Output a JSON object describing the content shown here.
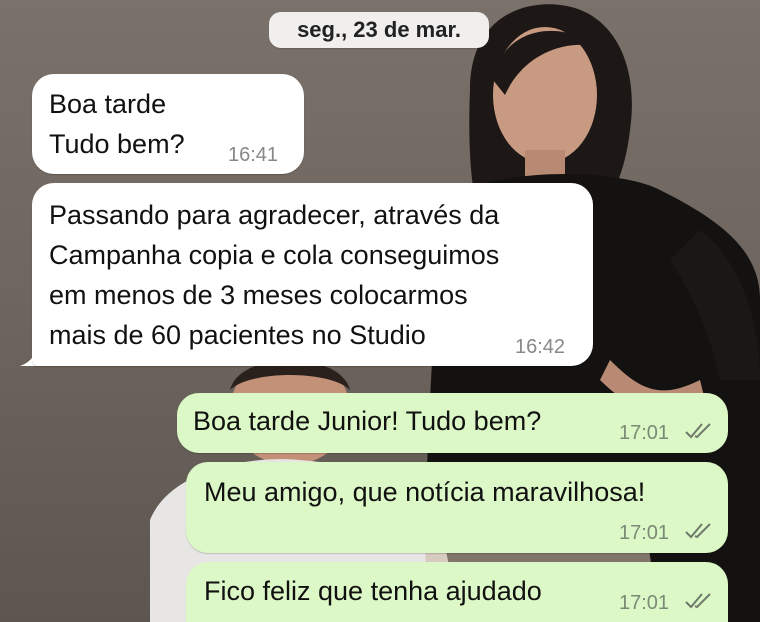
{
  "chat": {
    "date": "seg., 23 de mar.",
    "messages": [
      {
        "direction": "incoming",
        "lines": [
          "Boa tarde",
          "Tudo bem?"
        ],
        "time": "16:41"
      },
      {
        "direction": "incoming",
        "lines": [
          "Passando para agradecer, através da",
          "Campanha copia e cola conseguimos",
          "em menos de 3 meses colocarmos",
          "mais de 60 pacientes no Studio"
        ],
        "time": "16:42"
      },
      {
        "direction": "outgoing",
        "lines": [
          "Boa tarde Junior! Tudo bem?"
        ],
        "time": "17:01",
        "status": "read-double-check-icon"
      },
      {
        "direction": "outgoing",
        "lines": [
          "Meu amigo, que notícia maravilhosa!"
        ],
        "time": "17:01",
        "status": "read-double-check-icon"
      },
      {
        "direction": "outgoing",
        "lines": [
          "Fico feliz que tenha ajudado"
        ],
        "time": "17:01",
        "status": "read-double-check-icon"
      }
    ]
  },
  "colors": {
    "incoming_bubble": "#ffffff",
    "outgoing_bubble": "#dcf8c6",
    "date_pill": "#f1efee",
    "wallpaper": "#6f675f"
  }
}
